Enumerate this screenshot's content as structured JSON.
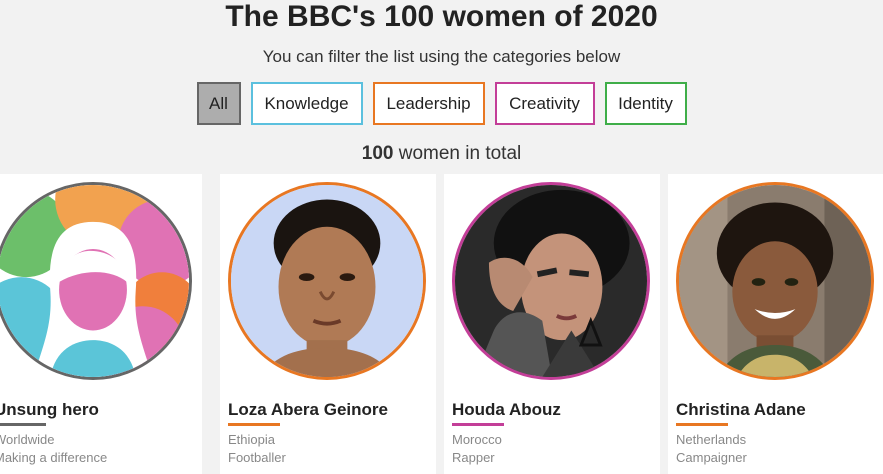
{
  "header": {
    "title": "The BBC's 100 women of 2020",
    "subtitle": "You can filter the list using the categories below"
  },
  "filters": [
    {
      "label": "All",
      "color": "#999999",
      "selected": true
    },
    {
      "label": "Knowledge",
      "color": "#5bc0de",
      "selected": false
    },
    {
      "label": "Leadership",
      "color": "#e87722",
      "selected": false
    },
    {
      "label": "Creativity",
      "color": "#c33e98",
      "selected": false
    },
    {
      "label": "Identity",
      "color": "#3fae49",
      "selected": false
    }
  ],
  "summary": {
    "count": "100",
    "suffix": " women in total"
  },
  "cards": [
    {
      "name": "Unsung hero",
      "country": "Worldwide",
      "role": "Making a difference",
      "category_color": "#666666",
      "image": "placeholder-silhouette"
    },
    {
      "name": "Loza Abera Geinore",
      "country": "Ethiopia",
      "role": "Footballer",
      "category_color": "#e87722",
      "image": "portrait"
    },
    {
      "name": "Houda Abouz",
      "country": "Morocco",
      "role": "Rapper",
      "category_color": "#c33e98",
      "image": "portrait"
    },
    {
      "name": "Christina Adane",
      "country": "Netherlands",
      "role": "Campaigner",
      "category_color": "#e87722",
      "image": "portrait"
    }
  ]
}
